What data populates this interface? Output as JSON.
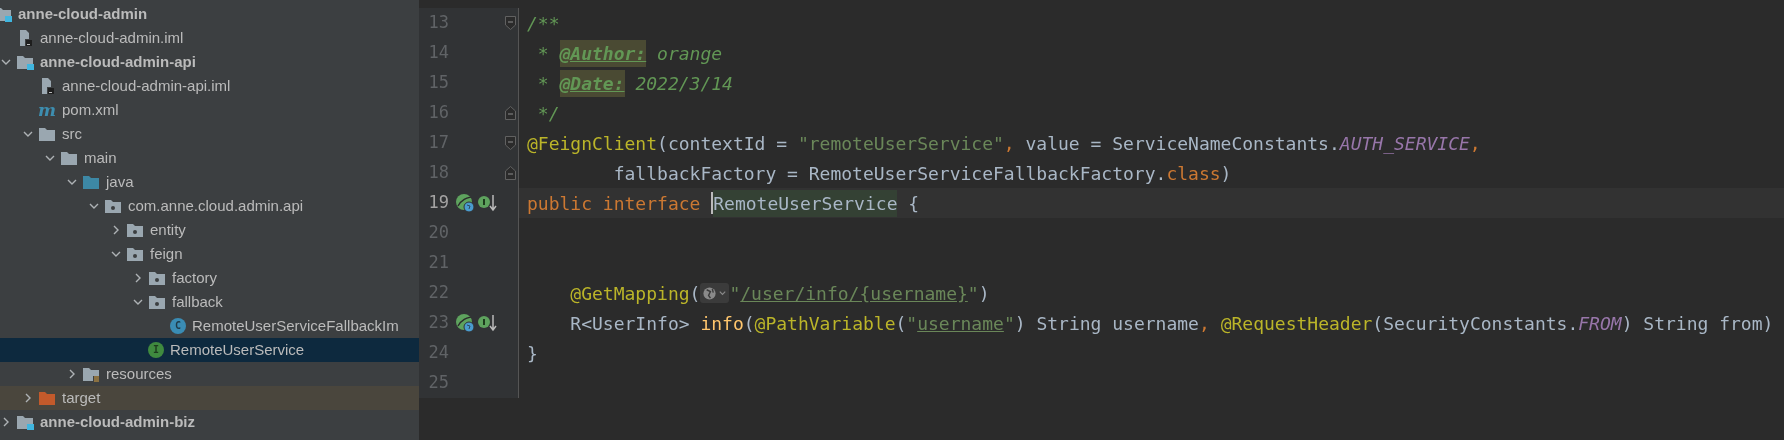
{
  "project_tree": {
    "items": [
      {
        "label": "anne-cloud-admin",
        "kind": "module",
        "selected": false,
        "children": [
          {
            "label": "anne-cloud-admin.iml",
            "kind": "iml",
            "selected": false
          },
          {
            "label": "anne-cloud-admin-api",
            "kind": "module",
            "expanded": true,
            "selected": false,
            "children": [
              {
                "label": "anne-cloud-admin-api.iml",
                "kind": "iml",
                "selected": false
              },
              {
                "label": "pom.xml",
                "kind": "maven",
                "badge": "m",
                "selected": false
              },
              {
                "label": "src",
                "kind": "folder",
                "expanded": true,
                "selected": false,
                "children": [
                  {
                    "label": "main",
                    "kind": "folder",
                    "expanded": true,
                    "selected": false,
                    "children": [
                      {
                        "label": "java",
                        "kind": "source-folder",
                        "expanded": true,
                        "selected": false,
                        "children": [
                          {
                            "label": "com.anne.cloud.admin.api",
                            "kind": "package",
                            "expanded": true,
                            "selected": false,
                            "children": [
                              {
                                "label": "entity",
                                "kind": "package",
                                "expanded": false,
                                "selected": false
                              },
                              {
                                "label": "feign",
                                "kind": "package",
                                "expanded": true,
                                "selected": false,
                                "children": [
                                  {
                                    "label": "factory",
                                    "kind": "package",
                                    "expanded": false,
                                    "selected": false
                                  },
                                  {
                                    "label": "fallback",
                                    "kind": "package",
                                    "expanded": true,
                                    "selected": false,
                                    "children": [
                                      {
                                        "label": "RemoteUserServiceFallbackIm",
                                        "kind": "class",
                                        "badge": "C",
                                        "selected": false
                                      }
                                    ]
                                  },
                                  {
                                    "label": "RemoteUserService",
                                    "kind": "interface",
                                    "badge": "I",
                                    "selected": true
                                  }
                                ]
                              }
                            ]
                          }
                        ]
                      },
                      {
                        "label": "resources",
                        "kind": "resources-folder",
                        "expanded": false,
                        "selected": false
                      }
                    ]
                  }
                ]
              },
              {
                "label": "target",
                "kind": "excluded-folder",
                "expanded": false,
                "selected": false
              }
            ]
          },
          {
            "label": "anne-cloud-admin-biz",
            "kind": "module",
            "expanded": false,
            "selected": false
          }
        ]
      }
    ]
  },
  "editor": {
    "lines": [
      {
        "number": "13",
        "current": false,
        "fold_open": true,
        "tokens": [
          {
            "kind": "comment",
            "text": "/**"
          }
        ]
      },
      {
        "number": "14",
        "current": false,
        "tokens": [
          {
            "kind": "comment",
            "text": " * "
          },
          {
            "kind": "doctag",
            "text": "@Author:"
          },
          {
            "kind": "comment",
            "text": " orange"
          }
        ]
      },
      {
        "number": "15",
        "current": false,
        "tokens": [
          {
            "kind": "comment",
            "text": " * "
          },
          {
            "kind": "doctag",
            "text": "@Date:"
          },
          {
            "kind": "comment",
            "text": " 2022/3/14"
          }
        ]
      },
      {
        "number": "16",
        "current": false,
        "fold_close": true,
        "tokens": [
          {
            "kind": "comment",
            "text": " */"
          }
        ]
      },
      {
        "number": "17",
        "current": false,
        "fold_open": true,
        "tokens": [
          {
            "kind": "annotation",
            "text": "@FeignClient"
          },
          {
            "kind": "plain",
            "text": "(contextId = "
          },
          {
            "kind": "string",
            "text": "\"remoteUserService\""
          },
          {
            "kind": "keyword",
            "text": ","
          },
          {
            "kind": "plain",
            "text": " value = ServiceNameConstants."
          },
          {
            "kind": "constant",
            "text": "AUTH_SERVICE"
          },
          {
            "kind": "keyword",
            "text": ","
          }
        ]
      },
      {
        "number": "18",
        "current": false,
        "fold_close": true,
        "tokens": [
          {
            "kind": "plain",
            "text": "        fallbackFactory = RemoteUserServiceFallbackFactory."
          },
          {
            "kind": "keyword",
            "text": "class"
          },
          {
            "kind": "plain",
            "text": ")"
          }
        ]
      },
      {
        "number": "19",
        "current": true,
        "bean_marker": true,
        "implemented_marker": true,
        "tokens": [
          {
            "kind": "keyword",
            "text": "public interface "
          },
          {
            "kind": "caret"
          },
          {
            "kind": "highlighted",
            "text": "RemoteUserService"
          },
          {
            "kind": "plain",
            "text": " {"
          }
        ]
      },
      {
        "number": "20",
        "current": false
      },
      {
        "number": "21",
        "current": false
      },
      {
        "number": "22",
        "current": false,
        "tokens": [
          {
            "kind": "annotation",
            "text": "    @GetMapping"
          },
          {
            "kind": "plain",
            "text": "("
          },
          {
            "kind": "inlay"
          },
          {
            "kind": "string",
            "text": "\""
          },
          {
            "kind": "url",
            "text": "/user/info/{username}"
          },
          {
            "kind": "string",
            "text": "\""
          },
          {
            "kind": "plain",
            "text": ")"
          }
        ]
      },
      {
        "number": "23",
        "current": false,
        "bean_marker": true,
        "implemented_marker": true,
        "tokens": [
          {
            "kind": "plain",
            "text": "    R<UserInfo> "
          },
          {
            "kind": "method",
            "text": "info"
          },
          {
            "kind": "plain",
            "text": "("
          },
          {
            "kind": "annotation",
            "text": "@PathVariable"
          },
          {
            "kind": "plain",
            "text": "("
          },
          {
            "kind": "string",
            "text": "\""
          },
          {
            "kind": "url",
            "text": "username"
          },
          {
            "kind": "string",
            "text": "\""
          },
          {
            "kind": "plain",
            "text": ") String username"
          },
          {
            "kind": "keyword",
            "text": ", "
          },
          {
            "kind": "annotation",
            "text": "@RequestHeader"
          },
          {
            "kind": "plain",
            "text": "(SecurityConstants."
          },
          {
            "kind": "constant",
            "text": "FROM"
          },
          {
            "kind": "plain",
            "text": ") String from)"
          }
        ]
      },
      {
        "number": "24",
        "current": false,
        "tokens": [
          {
            "kind": "plain",
            "text": "}"
          }
        ]
      },
      {
        "number": "25",
        "current": false
      }
    ]
  }
}
